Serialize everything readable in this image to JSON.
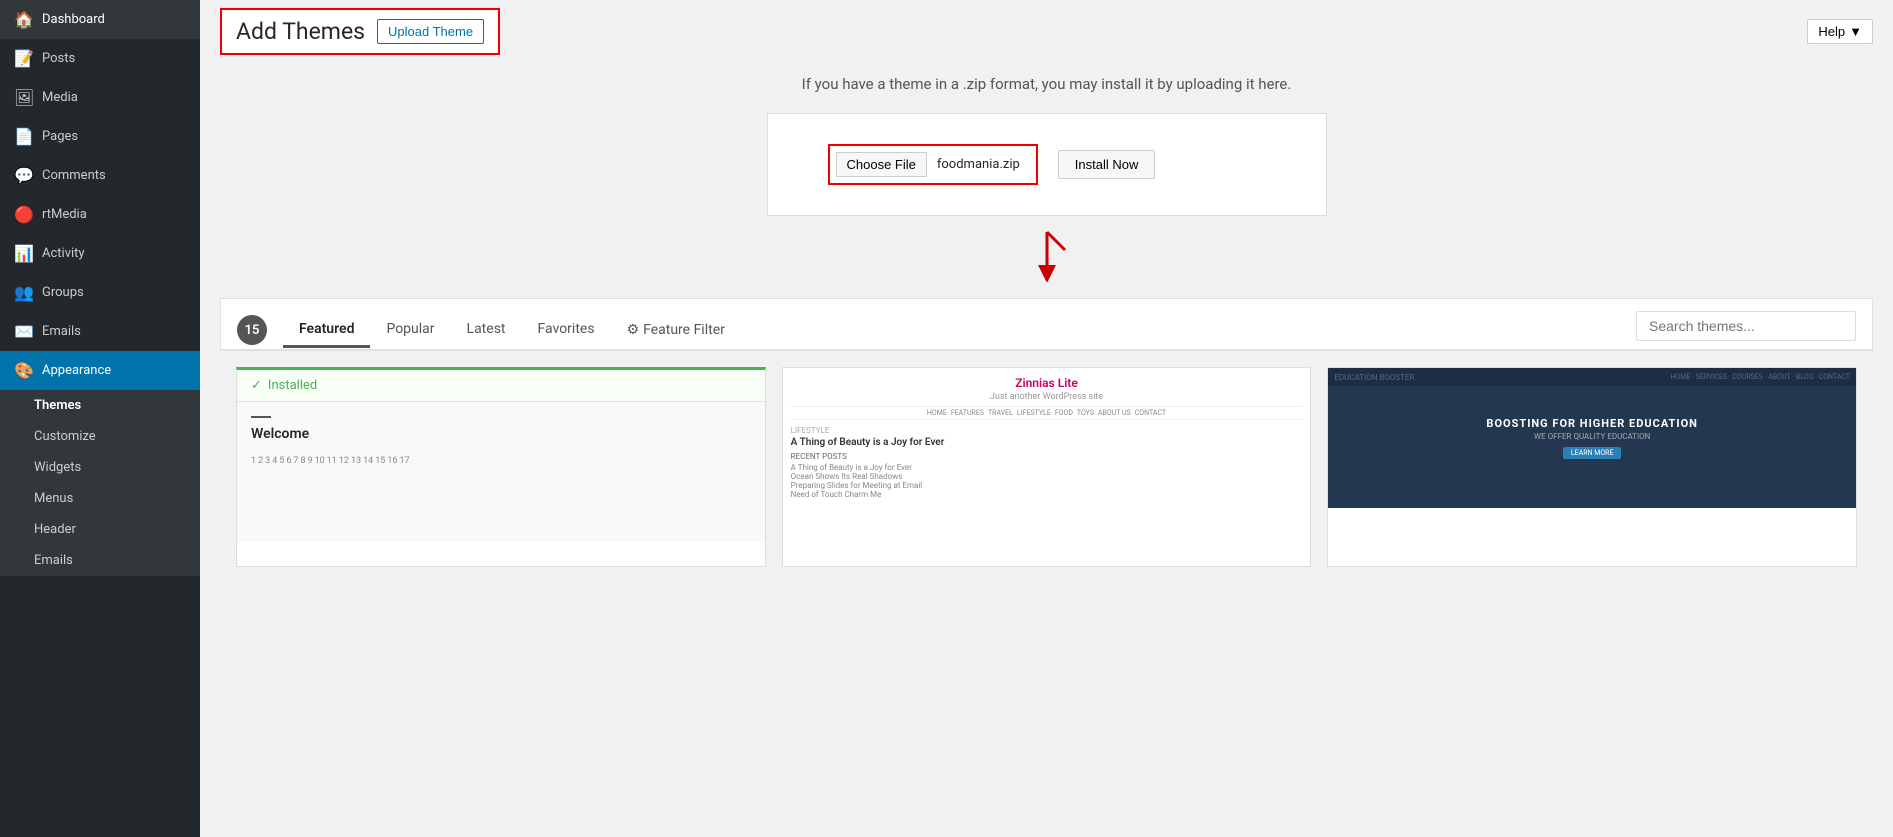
{
  "sidebar": {
    "items": [
      {
        "id": "dashboard",
        "label": "Dashboard",
        "icon": "🏠"
      },
      {
        "id": "posts",
        "label": "Posts",
        "icon": "📝"
      },
      {
        "id": "media",
        "label": "Media",
        "icon": "🖼"
      },
      {
        "id": "pages",
        "label": "Pages",
        "icon": "📄"
      },
      {
        "id": "comments",
        "label": "Comments",
        "icon": "💬"
      },
      {
        "id": "rtmedia",
        "label": "rtMedia",
        "icon": "🔴"
      },
      {
        "id": "activity",
        "label": "Activity",
        "icon": "📊"
      },
      {
        "id": "groups",
        "label": "Groups",
        "icon": "👥"
      },
      {
        "id": "emails",
        "label": "Emails",
        "icon": "✉️"
      },
      {
        "id": "appearance",
        "label": "Appearance",
        "icon": "🎨"
      }
    ],
    "submenu": [
      {
        "id": "themes",
        "label": "Themes"
      },
      {
        "id": "customize",
        "label": "Customize"
      },
      {
        "id": "widgets",
        "label": "Widgets"
      },
      {
        "id": "menus",
        "label": "Menus"
      },
      {
        "id": "header",
        "label": "Header"
      },
      {
        "id": "emails-sub",
        "label": "Emails"
      }
    ]
  },
  "header": {
    "page_title": "Add Themes",
    "upload_button": "Upload Theme",
    "help_button": "Help"
  },
  "upload_section": {
    "description": "If you have a theme in a .zip format, you may install it by uploading it here.",
    "choose_file_label": "Choose File",
    "file_name": "foodmania.zip",
    "install_button": "Install Now"
  },
  "tabs": {
    "count": "15",
    "items": [
      {
        "id": "featured",
        "label": "Featured",
        "active": true
      },
      {
        "id": "popular",
        "label": "Popular"
      },
      {
        "id": "latest",
        "label": "Latest"
      },
      {
        "id": "favorites",
        "label": "Favorites"
      },
      {
        "id": "feature-filter",
        "label": "Feature Filter"
      }
    ],
    "search_placeholder": "Search themes..."
  },
  "themes": [
    {
      "id": "installed",
      "installed": true,
      "installed_label": "Installed",
      "welcome": "Welcome"
    },
    {
      "id": "zinnias",
      "title": "Zinnias Lite",
      "subtitle": "Just another WordPress site",
      "post_title": "A Thing of Beauty is a Joy for Ever",
      "nav_items": [
        "HOME",
        "FEATURES",
        "TRAVEL",
        "LIFESTYLE",
        "FOOD",
        "TOYS",
        "ABOUT US",
        "CONTACT"
      ]
    },
    {
      "id": "education",
      "topbar_text": "EDUCATION BOOSTER",
      "headline": "BOOSTING FOR HIGHER EDUCATION",
      "sub": "WE OFFER QUALITY EDUCATION",
      "btn_label": "LEARN MORE"
    }
  ]
}
